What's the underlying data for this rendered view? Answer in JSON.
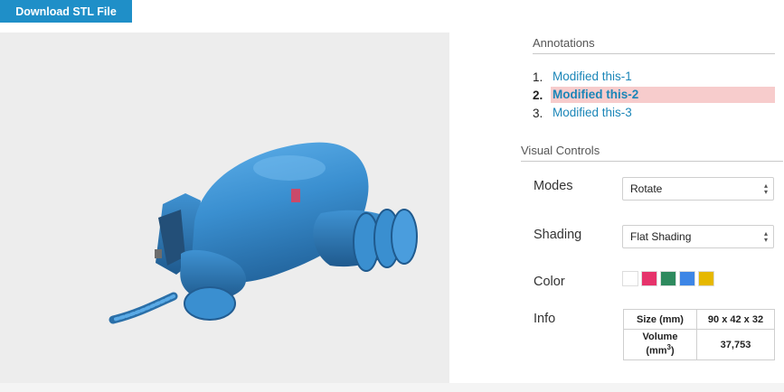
{
  "toolbar": {
    "download_label": "Download STL File"
  },
  "annotations": {
    "title": "Annotations",
    "items": [
      {
        "number": "1.",
        "label": "Modified this-1",
        "active": false
      },
      {
        "number": "2.",
        "label": "Modified this-2",
        "active": true
      },
      {
        "number": "3.",
        "label": "Modified this-3",
        "active": false
      }
    ]
  },
  "visual_controls": {
    "title": "Visual Controls",
    "modes": {
      "label": "Modes",
      "selected": "Rotate"
    },
    "shading": {
      "label": "Shading",
      "selected": "Flat Shading"
    },
    "color": {
      "label": "Color",
      "swatches": [
        "#ffffff",
        "#e6336b",
        "#2e8a5e",
        "#3d86e6",
        "#e6b800"
      ]
    },
    "info": {
      "label": "Info",
      "size_label": "Size (mm)",
      "size_value": "90 x 42 x 32",
      "volume_label": "Volume",
      "volume_unit": "(mm",
      "volume_unit_sup": "3",
      "volume_unit_close": ")",
      "volume_value": "37,753"
    }
  },
  "colors": {
    "accent": "#1f8fc8",
    "link": "#1b86b8",
    "highlight": "#f7cccc",
    "model": "#3a8fd0"
  }
}
